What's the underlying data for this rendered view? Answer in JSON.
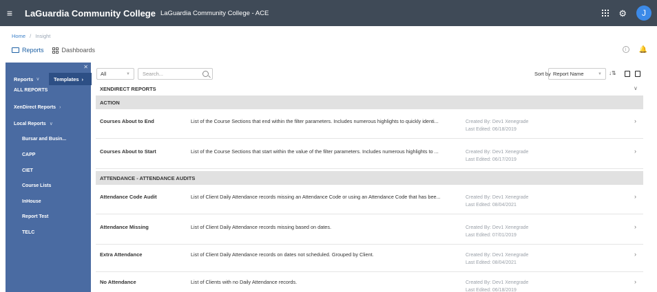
{
  "header": {
    "title": "LaGuardia Community College",
    "subtitle": "LaGuardia Community College - ACE",
    "avatar_initial": "J"
  },
  "breadcrumb": {
    "home": "Home",
    "sep": "/",
    "current": "Insight"
  },
  "tabs": {
    "reports": "Reports",
    "dashboards": "Dashboards"
  },
  "sidebar": {
    "reports_label": "Reports",
    "templates_label": "Templates",
    "all_reports": "ALL REPORTS",
    "xendirect": "XenDirect Reports",
    "local": "Local Reports",
    "local_items": [
      "Bursar and Busin...",
      "CAPP",
      "CIET",
      "Course Lists",
      "InHouse",
      "Report Test",
      "TELC"
    ]
  },
  "toolbar": {
    "filter_value": "All",
    "search_placeholder": "Search...",
    "sort_label": "Sort by",
    "sort_value": "Report Name"
  },
  "section_title": "XENDIRECT REPORTS",
  "groups": [
    {
      "name": "ACTION",
      "rows": [
        {
          "name": "Courses About to End",
          "desc": "List of the Course Sections that end within the filter parameters. Includes numerous highlights to quickly identi...",
          "created": "Created By: Dev1 Xenegrade",
          "edited": "Last Edited: 06/18/2019"
        },
        {
          "name": "Courses About to Start",
          "desc": "List of the Course Sections that start within the value of the filter parameters. Includes numerous highlights to ...",
          "created": "Created By: Dev1 Xenegrade",
          "edited": "Last Edited: 06/17/2019"
        }
      ]
    },
    {
      "name": "ATTENDANCE - ATTENDANCE AUDITS",
      "rows": [
        {
          "name": "Attendance Code Audit",
          "desc": "List of Client Daily Attendance records missing an Attendance Code or using an Attendance Code that has bee...",
          "created": "Created By: Dev1 Xenegrade",
          "edited": "Last Edited: 08/04/2021"
        },
        {
          "name": "Attendance Missing",
          "desc": "List of Client Daily Attendance records missing based on dates.",
          "created": "Created By: Dev1 Xenegrade",
          "edited": "Last Edited: 07/01/2019"
        },
        {
          "name": "Extra Attendance",
          "desc": "List of Client Daily Attendance records on dates not scheduled. Grouped by Client.",
          "created": "Created By: Dev1 Xenegrade",
          "edited": "Last Edited: 08/04/2021"
        },
        {
          "name": "No Attendance",
          "desc": "List of Clients with no Daily Attendance records.",
          "created": "Created By: Dev1 Xenegrade",
          "edited": "Last Edited: 06/18/2019"
        }
      ]
    }
  ]
}
